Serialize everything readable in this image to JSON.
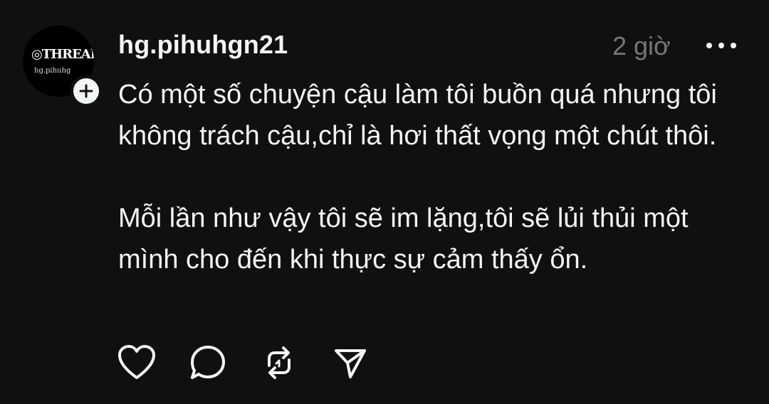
{
  "post": {
    "username": "hg.pihuhgn21",
    "time": "2 giờ",
    "avatar": {
      "logo_text": "THREADS",
      "sub_text": "hg.pihuhg"
    },
    "paragraphs": [
      "Có một số chuyện cậu làm tôi buồn quá nhưng tôi không trách cậu,chỉ là hơi thất vọng một chút thôi.",
      "Mỗi lần như vậy tôi sẽ im lặng,tôi sẽ lủi thủi một mình cho đến khi thực sự cảm thấy ổn."
    ]
  },
  "icons": {
    "follow": "plus-icon",
    "more": "more-dots-icon",
    "like": "heart-icon",
    "reply": "comment-icon",
    "repost": "repost-icon",
    "share": "send-icon"
  },
  "colors": {
    "background": "#101010",
    "text": "#f3f5f7",
    "muted": "#777777"
  }
}
